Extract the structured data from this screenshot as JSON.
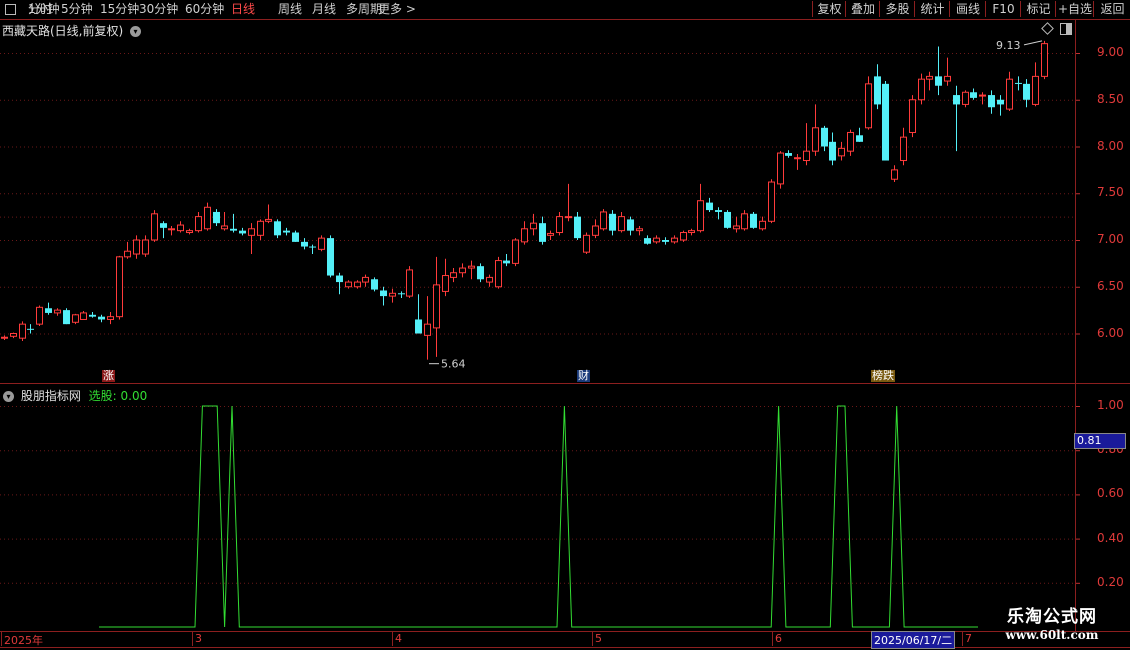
{
  "toolbar": {
    "left_items": [
      "分时",
      "1分钟",
      "5分钟",
      "15分钟",
      "30分钟",
      "60分钟",
      "日线",
      "周线",
      "月线",
      "多周期",
      "更多 >"
    ],
    "active_item": "日线",
    "right_items": [
      "复权",
      "叠加",
      "多股",
      "统计",
      "画线",
      "F10",
      "标记",
      "+自选",
      "返回"
    ]
  },
  "chart": {
    "stock_title": "西藏天路(日线,前复权)",
    "high_label": "9.13",
    "low_label": "5.64",
    "events": [
      {
        "text": "涨",
        "bg": "#8b1a1a"
      },
      {
        "text": "财",
        "bg": "#1a3a7a"
      },
      {
        "text": "榜跌",
        "bg": "#7a5a10"
      }
    ]
  },
  "indicator": {
    "name": "股朋指标网",
    "readout": "选股: 0.00",
    "current_value": "0.81"
  },
  "axis": {
    "price_ticks": [
      "9.00",
      "8.50",
      "8.00",
      "7.50",
      "7.00",
      "6.50",
      "6.00"
    ],
    "osc_ticks": [
      "1.00",
      "0.80",
      "0.60",
      "0.40",
      "0.20"
    ],
    "dates": [
      "2025年",
      "3",
      "4",
      "5",
      "6",
      "2025/06/17/二",
      "7"
    ]
  },
  "watermark": {
    "name": "乐淘公式网",
    "url": "www.60lt.com"
  },
  "colors": {
    "up": "#ff3b3b",
    "down": "#54f0f8",
    "grid": "#8c1f1f",
    "signal": "#33dd33"
  },
  "chart_data": {
    "type": "candlestick",
    "title": "西藏天路(日线,前复权)",
    "y_range": [
      5.5,
      9.4
    ],
    "candles": [
      {
        "o": 5.95,
        "h": 5.98,
        "l": 5.93,
        "c": 5.96
      },
      {
        "o": 5.97,
        "h": 6.01,
        "l": 5.95,
        "c": 6.0
      },
      {
        "o": 5.95,
        "h": 6.13,
        "l": 5.92,
        "c": 6.1
      },
      {
        "o": 6.05,
        "h": 6.1,
        "l": 6.0,
        "c": 6.04
      },
      {
        "o": 6.1,
        "h": 6.3,
        "l": 6.08,
        "c": 6.28
      },
      {
        "o": 6.27,
        "h": 6.33,
        "l": 6.2,
        "c": 6.22
      },
      {
        "o": 6.22,
        "h": 6.27,
        "l": 6.19,
        "c": 6.25
      },
      {
        "o": 6.25,
        "h": 6.27,
        "l": 6.1,
        "c": 6.1
      },
      {
        "o": 6.12,
        "h": 6.21,
        "l": 6.1,
        "c": 6.2
      },
      {
        "o": 6.15,
        "h": 6.24,
        "l": 6.15,
        "c": 6.22
      },
      {
        "o": 6.2,
        "h": 6.23,
        "l": 6.17,
        "c": 6.18
      },
      {
        "o": 6.18,
        "h": 6.2,
        "l": 6.12,
        "c": 6.15
      },
      {
        "o": 6.15,
        "h": 6.23,
        "l": 6.1,
        "c": 6.18
      },
      {
        "o": 6.18,
        "h": 6.83,
        "l": 6.15,
        "c": 6.82
      },
      {
        "o": 6.82,
        "h": 6.98,
        "l": 6.8,
        "c": 6.88
      },
      {
        "o": 6.85,
        "h": 7.05,
        "l": 6.8,
        "c": 7.0
      },
      {
        "o": 6.85,
        "h": 7.05,
        "l": 6.82,
        "c": 7.0
      },
      {
        "o": 7.0,
        "h": 7.32,
        "l": 6.98,
        "c": 7.28
      },
      {
        "o": 7.18,
        "h": 7.2,
        "l": 7.02,
        "c": 7.13
      },
      {
        "o": 7.12,
        "h": 7.15,
        "l": 7.05,
        "c": 7.12
      },
      {
        "o": 7.1,
        "h": 7.2,
        "l": 7.08,
        "c": 7.16
      },
      {
        "o": 7.08,
        "h": 7.12,
        "l": 7.06,
        "c": 7.1
      },
      {
        "o": 7.1,
        "h": 7.3,
        "l": 7.08,
        "c": 7.25
      },
      {
        "o": 7.12,
        "h": 7.4,
        "l": 7.1,
        "c": 7.35
      },
      {
        "o": 7.3,
        "h": 7.33,
        "l": 7.15,
        "c": 7.18
      },
      {
        "o": 7.12,
        "h": 7.3,
        "l": 7.1,
        "c": 7.15
      },
      {
        "o": 7.12,
        "h": 7.28,
        "l": 7.08,
        "c": 7.1
      },
      {
        "o": 7.1,
        "h": 7.13,
        "l": 7.05,
        "c": 7.07
      },
      {
        "o": 7.05,
        "h": 7.18,
        "l": 6.85,
        "c": 7.12
      },
      {
        "o": 7.05,
        "h": 7.22,
        "l": 7.0,
        "c": 7.2
      },
      {
        "o": 7.2,
        "h": 7.38,
        "l": 7.18,
        "c": 7.22
      },
      {
        "o": 7.2,
        "h": 7.22,
        "l": 7.02,
        "c": 7.05
      },
      {
        "o": 7.1,
        "h": 7.13,
        "l": 7.05,
        "c": 7.08
      },
      {
        "o": 7.08,
        "h": 7.1,
        "l": 6.98,
        "c": 6.98
      },
      {
        "o": 6.98,
        "h": 7.02,
        "l": 6.9,
        "c": 6.93
      },
      {
        "o": 6.93,
        "h": 6.95,
        "l": 6.85,
        "c": 6.92
      },
      {
        "o": 6.9,
        "h": 7.05,
        "l": 6.88,
        "c": 7.02
      },
      {
        "o": 7.02,
        "h": 7.05,
        "l": 6.6,
        "c": 6.62
      },
      {
        "o": 6.62,
        "h": 6.65,
        "l": 6.42,
        "c": 6.55
      },
      {
        "o": 6.5,
        "h": 6.57,
        "l": 6.48,
        "c": 6.55
      },
      {
        "o": 6.5,
        "h": 6.57,
        "l": 6.48,
        "c": 6.55
      },
      {
        "o": 6.55,
        "h": 6.63,
        "l": 6.5,
        "c": 6.6
      },
      {
        "o": 6.58,
        "h": 6.6,
        "l": 6.45,
        "c": 6.47
      },
      {
        "o": 6.46,
        "h": 6.5,
        "l": 6.3,
        "c": 6.4
      },
      {
        "o": 6.4,
        "h": 6.48,
        "l": 6.33,
        "c": 6.43
      },
      {
        "o": 6.43,
        "h": 6.45,
        "l": 6.38,
        "c": 6.42
      },
      {
        "o": 6.4,
        "h": 6.72,
        "l": 6.38,
        "c": 6.68
      },
      {
        "o": 6.15,
        "h": 6.42,
        "l": 6.0,
        "c": 6.0
      },
      {
        "o": 5.98,
        "h": 6.4,
        "l": 5.72,
        "c": 6.1
      },
      {
        "o": 6.06,
        "h": 6.82,
        "l": 5.75,
        "c": 6.52
      },
      {
        "o": 6.45,
        "h": 6.8,
        "l": 6.4,
        "c": 6.62
      },
      {
        "o": 6.6,
        "h": 6.7,
        "l": 6.55,
        "c": 6.65
      },
      {
        "o": 6.65,
        "h": 6.75,
        "l": 6.6,
        "c": 6.7
      },
      {
        "o": 6.7,
        "h": 6.78,
        "l": 6.58,
        "c": 6.72
      },
      {
        "o": 6.72,
        "h": 6.75,
        "l": 6.55,
        "c": 6.58
      },
      {
        "o": 6.55,
        "h": 6.63,
        "l": 6.5,
        "c": 6.6
      },
      {
        "o": 6.5,
        "h": 6.82,
        "l": 6.48,
        "c": 6.78
      },
      {
        "o": 6.78,
        "h": 6.85,
        "l": 6.72,
        "c": 6.75
      },
      {
        "o": 6.75,
        "h": 7.02,
        "l": 6.72,
        "c": 7.0
      },
      {
        "o": 6.98,
        "h": 7.2,
        "l": 6.95,
        "c": 7.12
      },
      {
        "o": 7.12,
        "h": 7.28,
        "l": 7.05,
        "c": 7.18
      },
      {
        "o": 7.18,
        "h": 7.25,
        "l": 6.95,
        "c": 6.98
      },
      {
        "o": 7.05,
        "h": 7.1,
        "l": 7.0,
        "c": 7.07
      },
      {
        "o": 7.08,
        "h": 7.3,
        "l": 7.05,
        "c": 7.25
      },
      {
        "o": 7.25,
        "h": 7.6,
        "l": 7.2,
        "c": 7.25
      },
      {
        "o": 7.25,
        "h": 7.3,
        "l": 7.0,
        "c": 7.02
      },
      {
        "o": 6.87,
        "h": 7.08,
        "l": 6.85,
        "c": 7.05
      },
      {
        "o": 7.05,
        "h": 7.22,
        "l": 7.02,
        "c": 7.15
      },
      {
        "o": 7.12,
        "h": 7.33,
        "l": 7.1,
        "c": 7.3
      },
      {
        "o": 7.28,
        "h": 7.32,
        "l": 7.05,
        "c": 7.1
      },
      {
        "o": 7.1,
        "h": 7.3,
        "l": 7.08,
        "c": 7.25
      },
      {
        "o": 7.22,
        "h": 7.25,
        "l": 7.05,
        "c": 7.1
      },
      {
        "o": 7.1,
        "h": 7.15,
        "l": 7.05,
        "c": 7.12
      },
      {
        "o": 7.02,
        "h": 7.05,
        "l": 6.95,
        "c": 6.96
      },
      {
        "o": 6.98,
        "h": 7.05,
        "l": 6.96,
        "c": 7.02
      },
      {
        "o": 7.0,
        "h": 7.03,
        "l": 6.95,
        "c": 6.98
      },
      {
        "o": 6.98,
        "h": 7.05,
        "l": 6.96,
        "c": 7.02
      },
      {
        "o": 7.0,
        "h": 7.1,
        "l": 6.98,
        "c": 7.08
      },
      {
        "o": 7.08,
        "h": 7.12,
        "l": 7.05,
        "c": 7.1
      },
      {
        "o": 7.1,
        "h": 7.6,
        "l": 7.08,
        "c": 7.42
      },
      {
        "o": 7.4,
        "h": 7.45,
        "l": 7.3,
        "c": 7.32
      },
      {
        "o": 7.32,
        "h": 7.35,
        "l": 7.22,
        "c": 7.3
      },
      {
        "o": 7.3,
        "h": 7.32,
        "l": 7.12,
        "c": 7.13
      },
      {
        "o": 7.12,
        "h": 7.25,
        "l": 7.08,
        "c": 7.15
      },
      {
        "o": 7.12,
        "h": 7.32,
        "l": 7.1,
        "c": 7.28
      },
      {
        "o": 7.28,
        "h": 7.3,
        "l": 7.12,
        "c": 7.13
      },
      {
        "o": 7.12,
        "h": 7.25,
        "l": 7.1,
        "c": 7.2
      },
      {
        "o": 7.2,
        "h": 7.65,
        "l": 7.18,
        "c": 7.62
      },
      {
        "o": 7.6,
        "h": 7.95,
        "l": 7.55,
        "c": 7.93
      },
      {
        "o": 7.93,
        "h": 7.96,
        "l": 7.88,
        "c": 7.9
      },
      {
        "o": 7.88,
        "h": 7.92,
        "l": 7.75,
        "c": 7.88
      },
      {
        "o": 7.85,
        "h": 8.25,
        "l": 7.8,
        "c": 7.95
      },
      {
        "o": 7.95,
        "h": 8.45,
        "l": 7.9,
        "c": 8.2
      },
      {
        "o": 8.2,
        "h": 8.22,
        "l": 7.95,
        "c": 8.0
      },
      {
        "o": 8.05,
        "h": 8.15,
        "l": 7.8,
        "c": 7.85
      },
      {
        "o": 7.9,
        "h": 8.05,
        "l": 7.85,
        "c": 7.98
      },
      {
        "o": 7.95,
        "h": 8.18,
        "l": 7.9,
        "c": 8.15
      },
      {
        "o": 8.12,
        "h": 8.2,
        "l": 8.05,
        "c": 8.05
      },
      {
        "o": 8.2,
        "h": 8.75,
        "l": 8.18,
        "c": 8.67
      },
      {
        "o": 8.75,
        "h": 8.88,
        "l": 8.4,
        "c": 8.45
      },
      {
        "o": 8.67,
        "h": 8.7,
        "l": 7.85,
        "c": 7.85
      },
      {
        "o": 7.65,
        "h": 7.8,
        "l": 7.62,
        "c": 7.75
      },
      {
        "o": 7.85,
        "h": 8.2,
        "l": 7.8,
        "c": 8.1
      },
      {
        "o": 8.15,
        "h": 8.55,
        "l": 8.1,
        "c": 8.5
      },
      {
        "o": 8.5,
        "h": 8.78,
        "l": 8.45,
        "c": 8.72
      },
      {
        "o": 8.72,
        "h": 8.8,
        "l": 8.6,
        "c": 8.75
      },
      {
        "o": 8.75,
        "h": 9.07,
        "l": 8.55,
        "c": 8.65
      },
      {
        "o": 8.7,
        "h": 8.95,
        "l": 8.65,
        "c": 8.75
      },
      {
        "o": 8.55,
        "h": 8.65,
        "l": 7.95,
        "c": 8.45
      },
      {
        "o": 8.45,
        "h": 8.6,
        "l": 8.42,
        "c": 8.58
      },
      {
        "o": 8.58,
        "h": 8.62,
        "l": 8.5,
        "c": 8.52
      },
      {
        "o": 8.55,
        "h": 8.58,
        "l": 8.45,
        "c": 8.55
      },
      {
        "o": 8.55,
        "h": 8.6,
        "l": 8.35,
        "c": 8.42
      },
      {
        "o": 8.5,
        "h": 8.55,
        "l": 8.33,
        "c": 8.45
      },
      {
        "o": 8.4,
        "h": 8.8,
        "l": 8.38,
        "c": 8.72
      },
      {
        "o": 8.68,
        "h": 8.75,
        "l": 8.6,
        "c": 8.67
      },
      {
        "o": 8.67,
        "h": 8.72,
        "l": 8.42,
        "c": 8.5
      },
      {
        "o": 8.45,
        "h": 8.9,
        "l": 8.43,
        "c": 8.75
      },
      {
        "o": 8.75,
        "h": 9.13,
        "l": 8.72,
        "c": 9.1
      }
    ],
    "signal": [
      0,
      0,
      0,
      0,
      0,
      0,
      0,
      0,
      0,
      0,
      0,
      0,
      0,
      0,
      1,
      1,
      1,
      0,
      1,
      0,
      0,
      0,
      0,
      0,
      0,
      0,
      0,
      0,
      0,
      0,
      0,
      0,
      0,
      0,
      0,
      0,
      0,
      0,
      0,
      0,
      0,
      0,
      0,
      0,
      0,
      0,
      0,
      0,
      0,
      0,
      0,
      0,
      0,
      0,
      0,
      0,
      0,
      0,
      0,
      0,
      0,
      0,
      0,
      1,
      0,
      0,
      0,
      0,
      0,
      0,
      0,
      0,
      0,
      0,
      0,
      0,
      0,
      0,
      0,
      0,
      0,
      0,
      0,
      0,
      0,
      0,
      0,
      0,
      0,
      0,
      0,
      0,
      1,
      0,
      0,
      0,
      0,
      0,
      0,
      0,
      1,
      1,
      0,
      0,
      0,
      0,
      0,
      0,
      1,
      0,
      0,
      0,
      0,
      0,
      0,
      0,
      0,
      0,
      0,
      0
    ]
  }
}
